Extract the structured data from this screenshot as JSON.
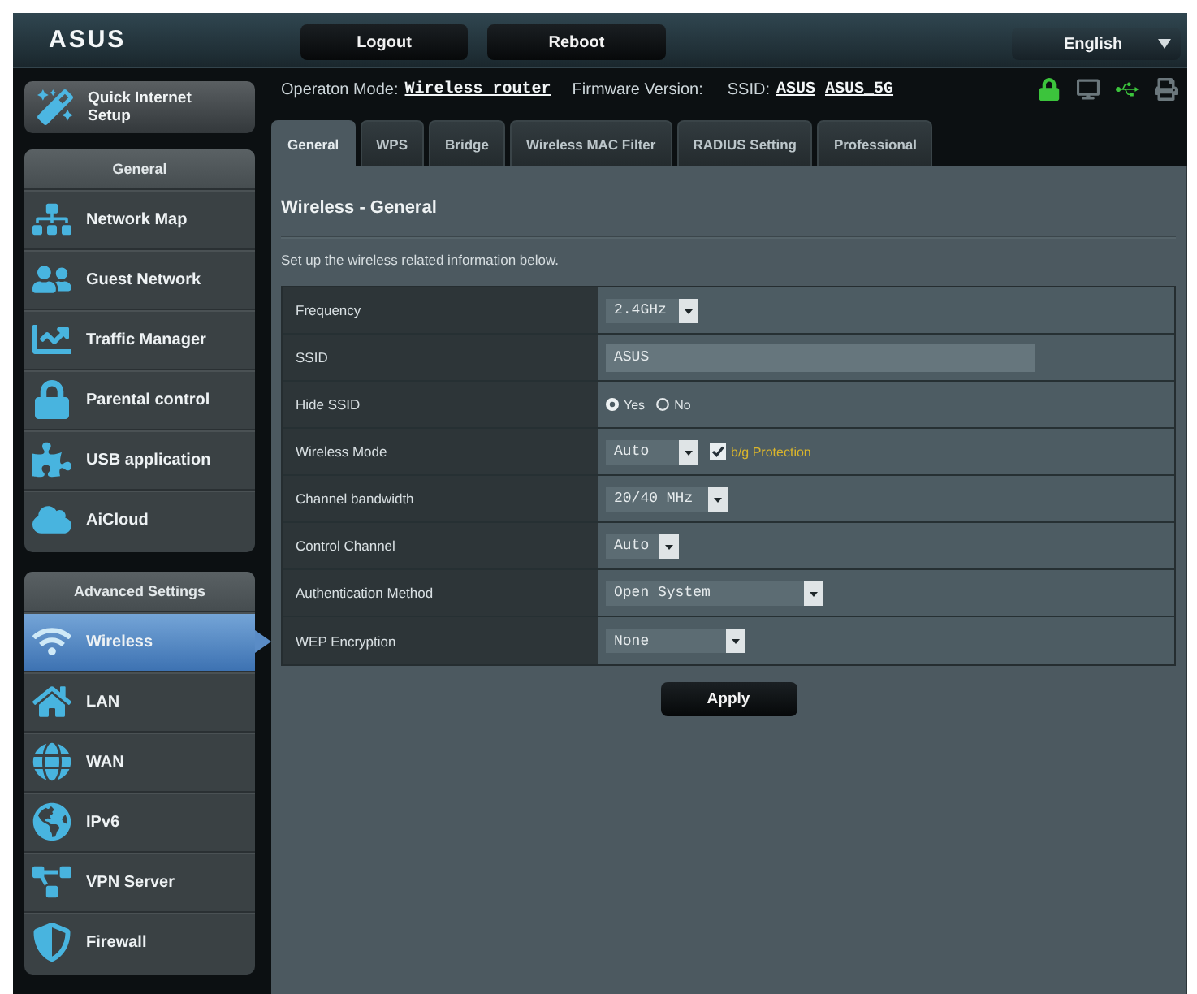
{
  "header": {
    "logo": "ASUS",
    "buttons": [
      "Logout",
      "Reboot"
    ],
    "language": "English"
  },
  "info_bar": {
    "mode_label": "Operaton Mode:",
    "mode": "Wireless router",
    "firmware_label": "Firmware Version:",
    "ssid_label": "SSID:",
    "ssids": [
      "ASUS",
      "ASUS_5G"
    ],
    "status_icons": [
      {
        "kind": "lock",
        "on": true
      },
      {
        "kind": "devices",
        "on": false
      },
      {
        "kind": "usb",
        "on": true
      },
      {
        "kind": "printer",
        "on": false
      }
    ]
  },
  "sidebar": {
    "quick_setup": "Quick Internet Setup",
    "sections": [
      {
        "title": "General",
        "items": [
          {
            "label": "Network Map",
            "selected": false
          },
          {
            "label": "Guest Network",
            "selected": false
          },
          {
            "label": "Traffic Manager",
            "selected": false
          },
          {
            "label": "Parental control",
            "selected": false
          },
          {
            "label": "USB application",
            "selected": false
          },
          {
            "label": "AiCloud",
            "selected": false
          }
        ]
      },
      {
        "title": "Advanced Settings",
        "items": [
          {
            "label": "Wireless",
            "selected": true
          },
          {
            "label": "LAN",
            "selected": false
          },
          {
            "label": "WAN",
            "selected": false
          },
          {
            "label": "IPv6",
            "selected": false
          },
          {
            "label": "VPN Server",
            "selected": false
          },
          {
            "label": "Firewall",
            "selected": false
          }
        ]
      }
    ]
  },
  "tabs": [
    {
      "label": "General",
      "selected": true
    },
    {
      "label": "WPS",
      "selected": false
    },
    {
      "label": "Bridge",
      "selected": false
    },
    {
      "label": "Wireless MAC Filter",
      "selected": false
    },
    {
      "label": "RADIUS Setting",
      "selected": false
    },
    {
      "label": "Professional",
      "selected": false
    }
  ],
  "panel": {
    "title": "Wireless - General",
    "description": "Set up the wireless related information below.",
    "rows": [
      {
        "label": "Frequency",
        "kind": "select",
        "value": "2.4GHz"
      },
      {
        "label": "SSID",
        "kind": "input",
        "value": "ASUS"
      },
      {
        "label": "Hide SSID",
        "kind": "radio",
        "options": [
          {
            "label": "Yes",
            "selected": true
          },
          {
            "label": "No",
            "selected": false
          }
        ]
      },
      {
        "label": "Wireless Mode",
        "kind": "select",
        "value": "Auto",
        "checkbox": {
          "label": "b/g Protection",
          "checked": true
        }
      },
      {
        "label": "Channel bandwidth",
        "kind": "select",
        "value": "20/40 MHz"
      },
      {
        "label": "Control Channel",
        "kind": "select",
        "value": "Auto"
      },
      {
        "label": "Authentication Method",
        "kind": "select",
        "value": "Open System"
      },
      {
        "label": "WEP Encryption",
        "kind": "select",
        "value": "None"
      }
    ],
    "apply": "Apply"
  }
}
